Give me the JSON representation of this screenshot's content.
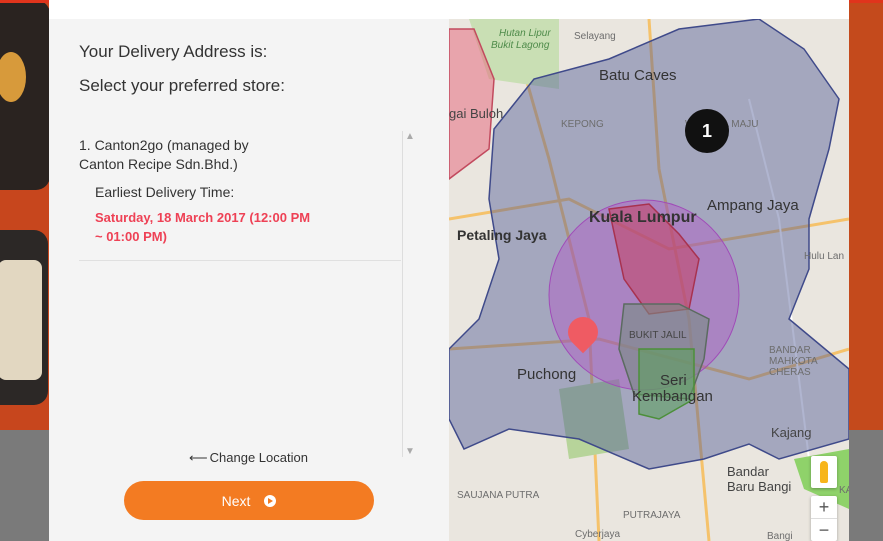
{
  "header": {
    "title": "Your Delivery Address is:",
    "subtitle": "Select your preferred store:"
  },
  "stores": [
    {
      "name": "1. Canton2go (managed by Canton Recipe Sdn.Bhd.)",
      "delivery_label": "Earliest Delivery Time:",
      "delivery_time": "Saturday, 18 March 2017 (12:00 PM ~ 01:00 PM)"
    }
  ],
  "actions": {
    "change_location": "Change Location",
    "next": "Next"
  },
  "map": {
    "cluster_count": "1",
    "zoom_in": "+",
    "zoom_out": "−",
    "labels": {
      "hutan": "Hutan Lipur",
      "bukit_lagong": "Bukit Lagong",
      "selayang": "Selayang",
      "batu_caves": "Batu Caves",
      "kepong": "KEPONG",
      "wangsa_maju": "WANGSA MAJU",
      "sungai_buloh": "gai Buloh",
      "kuala_lumpur": "Kuala Lumpur",
      "ampang_jaya": "Ampang Jaya",
      "petaling_jaya": "Petaling Jaya",
      "hulu_lang": "Hulu Lan",
      "bukit_jalil": "BUKIT JALIL",
      "puchong": "Puchong",
      "seri": "Seri",
      "kembangan": "Kembangan",
      "bandar_mahkota": "BANDAR MAHKOTA CHERAS",
      "kajang": "Kajang",
      "bandar_baru_bangi": "Bandar Baru Bangi",
      "saujana_putra": "SAUJANA PUTRA",
      "putrajaya": "PUTRAJAYA",
      "cyberjaya": "Cyberjaya",
      "bangi": "Bangi",
      "kajang_right": "KAJANG"
    }
  },
  "colors": {
    "accent": "#f37b22",
    "delivery_time": "#ee4155",
    "cluster": "#111111"
  }
}
